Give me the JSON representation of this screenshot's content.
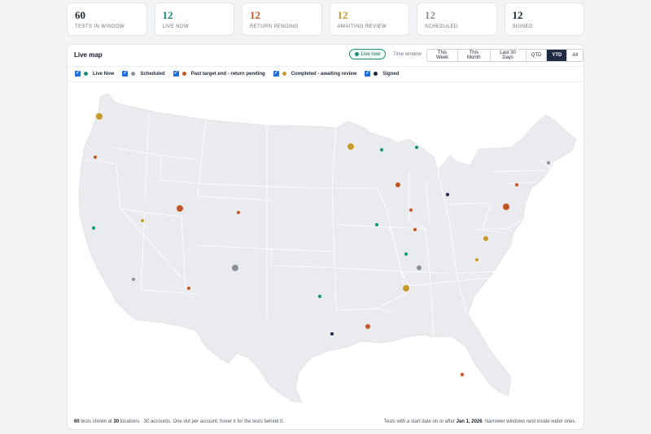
{
  "stats": [
    {
      "value": "60",
      "label": "Tests in window",
      "color": "#1f2937"
    },
    {
      "value": "12",
      "label": "Live now",
      "color": "#1a8f74"
    },
    {
      "value": "12",
      "label": "Return pending",
      "color": "#c0572b"
    },
    {
      "value": "12",
      "label": "Awaiting review",
      "color": "#c49a2f"
    },
    {
      "value": "12",
      "label": "Scheduled",
      "color": "#8a8f9c"
    },
    {
      "value": "12",
      "label": "Signed",
      "color": "#1f2937"
    }
  ],
  "panel": {
    "title": "Live map",
    "live_pill": "Live now",
    "time_window_label": "Time window",
    "time_windows": [
      "This Week",
      "This Month",
      "Last 30 Days",
      "QTD",
      "YTD",
      "All"
    ],
    "active_window": "YTD"
  },
  "legend": [
    {
      "label": "Live Now",
      "color": "#1a8f74",
      "checked": true
    },
    {
      "label": "Scheduled",
      "color": "#8a8f9c",
      "checked": true
    },
    {
      "label": "Past target end - return pending",
      "color": "#c0572b",
      "checked": true
    },
    {
      "label": "Completed - awaiting review",
      "color": "#c49a2f",
      "checked": true
    },
    {
      "label": "Signed",
      "color": "#1f2a44",
      "checked": true
    }
  ],
  "colors": {
    "live": "#1a8f74",
    "scheduled": "#8a8f9c",
    "pending": "#c0572b",
    "review": "#c49a2f",
    "signed": "#1f2a44",
    "land": "#e9ebef",
    "border": "#ffffff"
  },
  "map": {
    "region": "Contiguous United States",
    "markers": [
      {
        "lat": 47.3,
        "lon": -122.3,
        "status": "review",
        "size": "large"
      },
      {
        "lat": 44.0,
        "lon": -122.8,
        "status": "pending",
        "size": "small"
      },
      {
        "lat": 38.3,
        "lon": -123.0,
        "status": "live",
        "size": "small"
      },
      {
        "lat": 38.9,
        "lon": -117.3,
        "status": "review",
        "size": "small"
      },
      {
        "lat": 39.9,
        "lon": -113.0,
        "status": "pending",
        "size": "large"
      },
      {
        "lat": 39.6,
        "lon": -106.2,
        "status": "pending",
        "size": "small"
      },
      {
        "lat": 34.2,
        "lon": -118.4,
        "status": "scheduled",
        "size": "small"
      },
      {
        "lat": 33.5,
        "lon": -112.0,
        "status": "pending",
        "size": "small"
      },
      {
        "lat": 35.1,
        "lon": -106.6,
        "status": "scheduled",
        "size": "large"
      },
      {
        "lat": 32.8,
        "lon": -96.8,
        "status": "live",
        "size": "small"
      },
      {
        "lat": 29.8,
        "lon": -95.4,
        "status": "signed",
        "size": "small"
      },
      {
        "lat": 30.4,
        "lon": -91.2,
        "status": "pending",
        "size": "medium"
      },
      {
        "lat": 44.9,
        "lon": -93.2,
        "status": "review",
        "size": "large"
      },
      {
        "lat": 44.6,
        "lon": -89.6,
        "status": "live",
        "size": "small"
      },
      {
        "lat": 44.8,
        "lon": -85.6,
        "status": "live",
        "size": "small"
      },
      {
        "lat": 41.8,
        "lon": -87.7,
        "status": "pending",
        "size": "medium"
      },
      {
        "lat": 39.8,
        "lon": -86.2,
        "status": "pending",
        "size": "small"
      },
      {
        "lat": 41.0,
        "lon": -82.0,
        "status": "signed",
        "size": "small"
      },
      {
        "lat": 38.6,
        "lon": -90.2,
        "status": "live",
        "size": "small"
      },
      {
        "lat": 38.2,
        "lon": -85.8,
        "status": "pending",
        "size": "small"
      },
      {
        "lat": 36.2,
        "lon": -86.8,
        "status": "live",
        "size": "small"
      },
      {
        "lat": 35.1,
        "lon": -85.3,
        "status": "scheduled",
        "size": "medium"
      },
      {
        "lat": 33.5,
        "lon": -86.8,
        "status": "review",
        "size": "large"
      },
      {
        "lat": 37.5,
        "lon": -77.6,
        "status": "review",
        "size": "medium"
      },
      {
        "lat": 35.8,
        "lon": -78.6,
        "status": "review",
        "size": "small"
      },
      {
        "lat": 40.0,
        "lon": -75.2,
        "status": "pending",
        "size": "large"
      },
      {
        "lat": 41.8,
        "lon": -74.0,
        "status": "pending",
        "size": "small"
      },
      {
        "lat": 43.6,
        "lon": -70.3,
        "status": "scheduled",
        "size": "small"
      },
      {
        "lat": 26.5,
        "lon": -80.3,
        "status": "pending",
        "size": "small"
      }
    ]
  },
  "footer": {
    "count_tests": "60",
    "text_tests": " tests shown at ",
    "count_locations": "30",
    "text_rest": " locations · 30 accounts. One dot per account; hover it for the tests behind it.",
    "note_prefix": "Tests with a start date on or after ",
    "note_date": "Jan 1, 2026",
    "note_suffix": ". Narrower windows nest inside wider ones."
  }
}
